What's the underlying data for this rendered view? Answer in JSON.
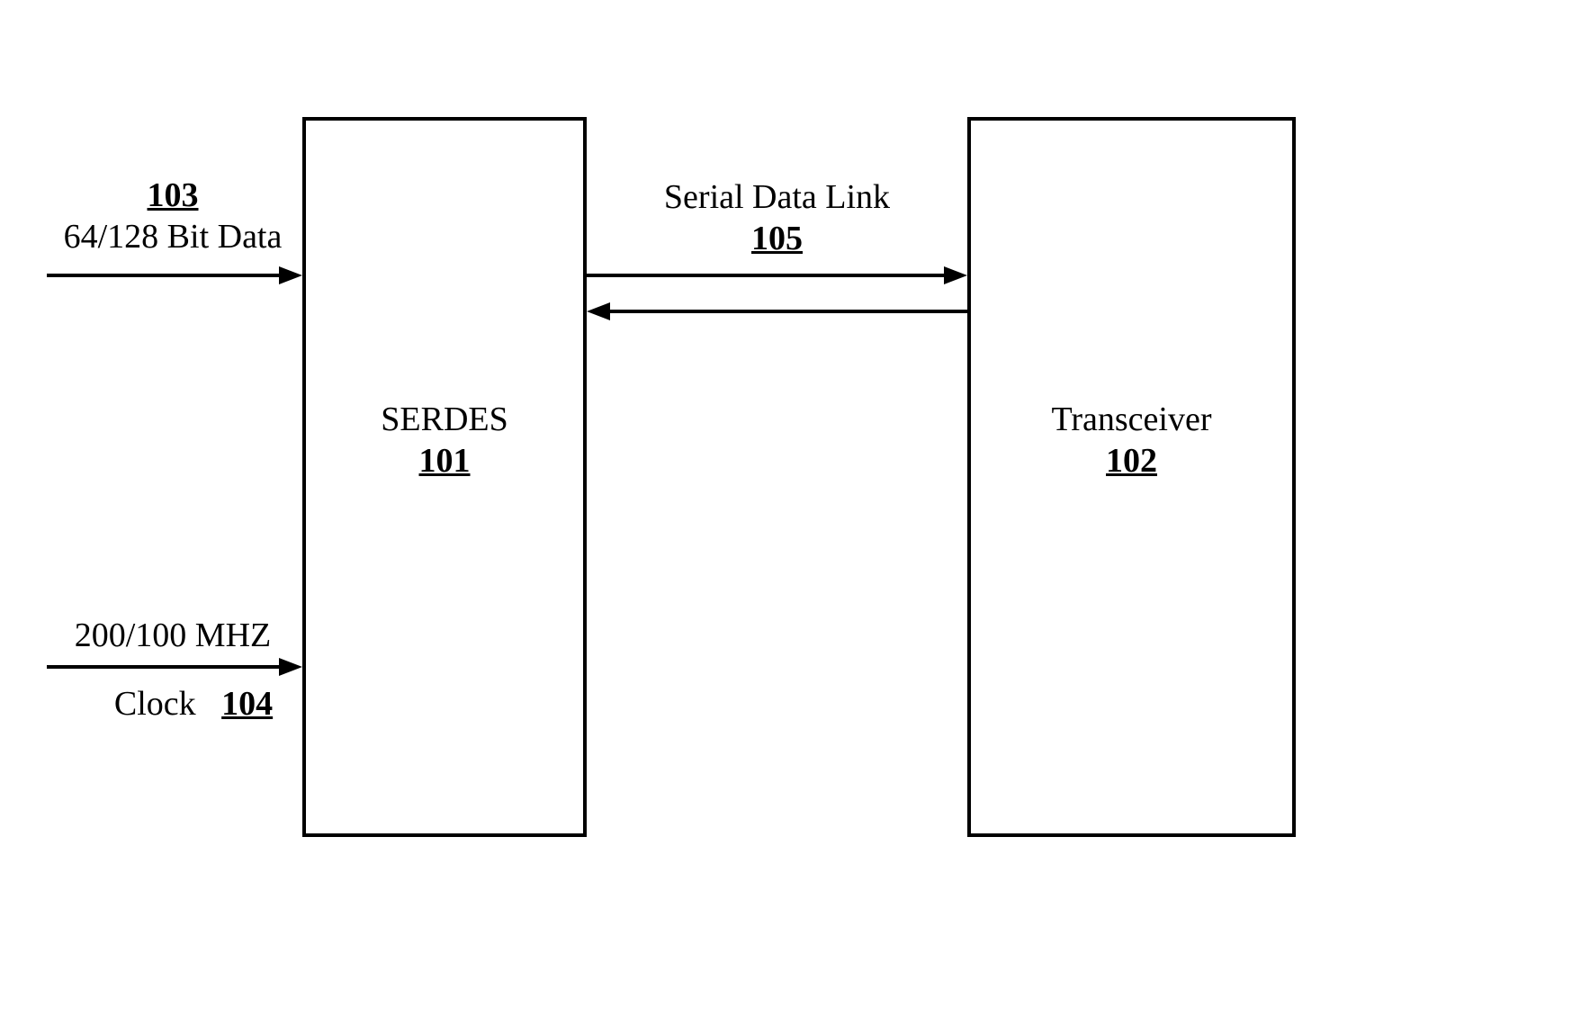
{
  "blocks": {
    "serdes": {
      "name": "SERDES",
      "ref": "101"
    },
    "transceiver": {
      "name": "Transceiver",
      "ref": "102"
    }
  },
  "signals": {
    "data": {
      "ref": "103",
      "desc": "64/128 Bit Data"
    },
    "clock": {
      "ref": "104",
      "rate": "200/100 MHZ",
      "label": "Clock"
    },
    "link": {
      "label": "Serial Data Link",
      "ref": "105"
    }
  }
}
